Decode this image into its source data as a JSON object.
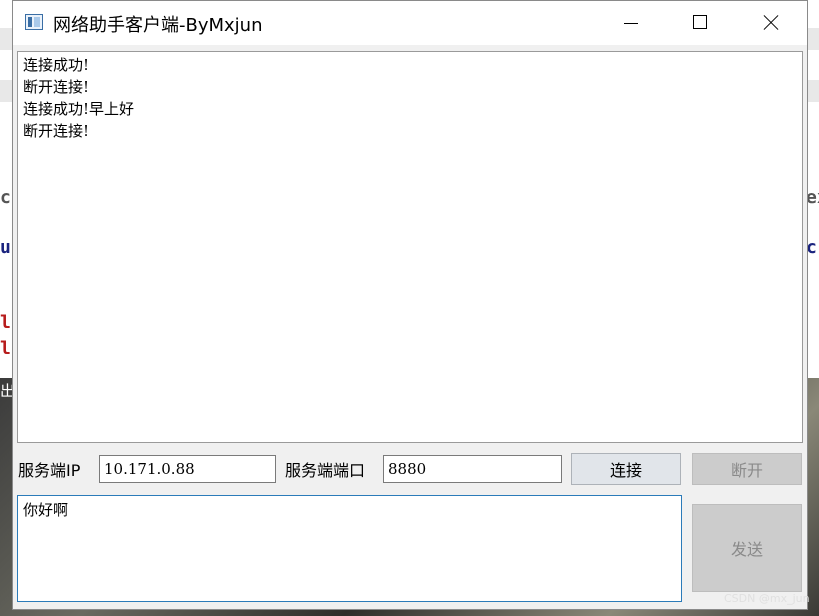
{
  "window": {
    "title": "网络助手客户端-ByMxjun"
  },
  "log": {
    "lines": [
      "连接成功!",
      "断开连接!",
      "连接成功!早上好",
      "断开连接!"
    ]
  },
  "connection": {
    "ip_label": "服务端IP",
    "ip_value": "10.171.0.88",
    "port_label": "服务端端口",
    "port_value": "8880",
    "connect_label": "连接",
    "disconnect_label": "断开"
  },
  "message": {
    "value": "你好啊",
    "send_label": "发送"
  },
  "background": {
    "fragments": [
      "c",
      "u",
      "l",
      "l",
      "出",
      "ex",
      "cr"
    ]
  },
  "watermark": "CSDN @mx_jun",
  "colors": {
    "input_focus_border": "#2b7bb9",
    "disabled_text": "#8a8a8a"
  }
}
